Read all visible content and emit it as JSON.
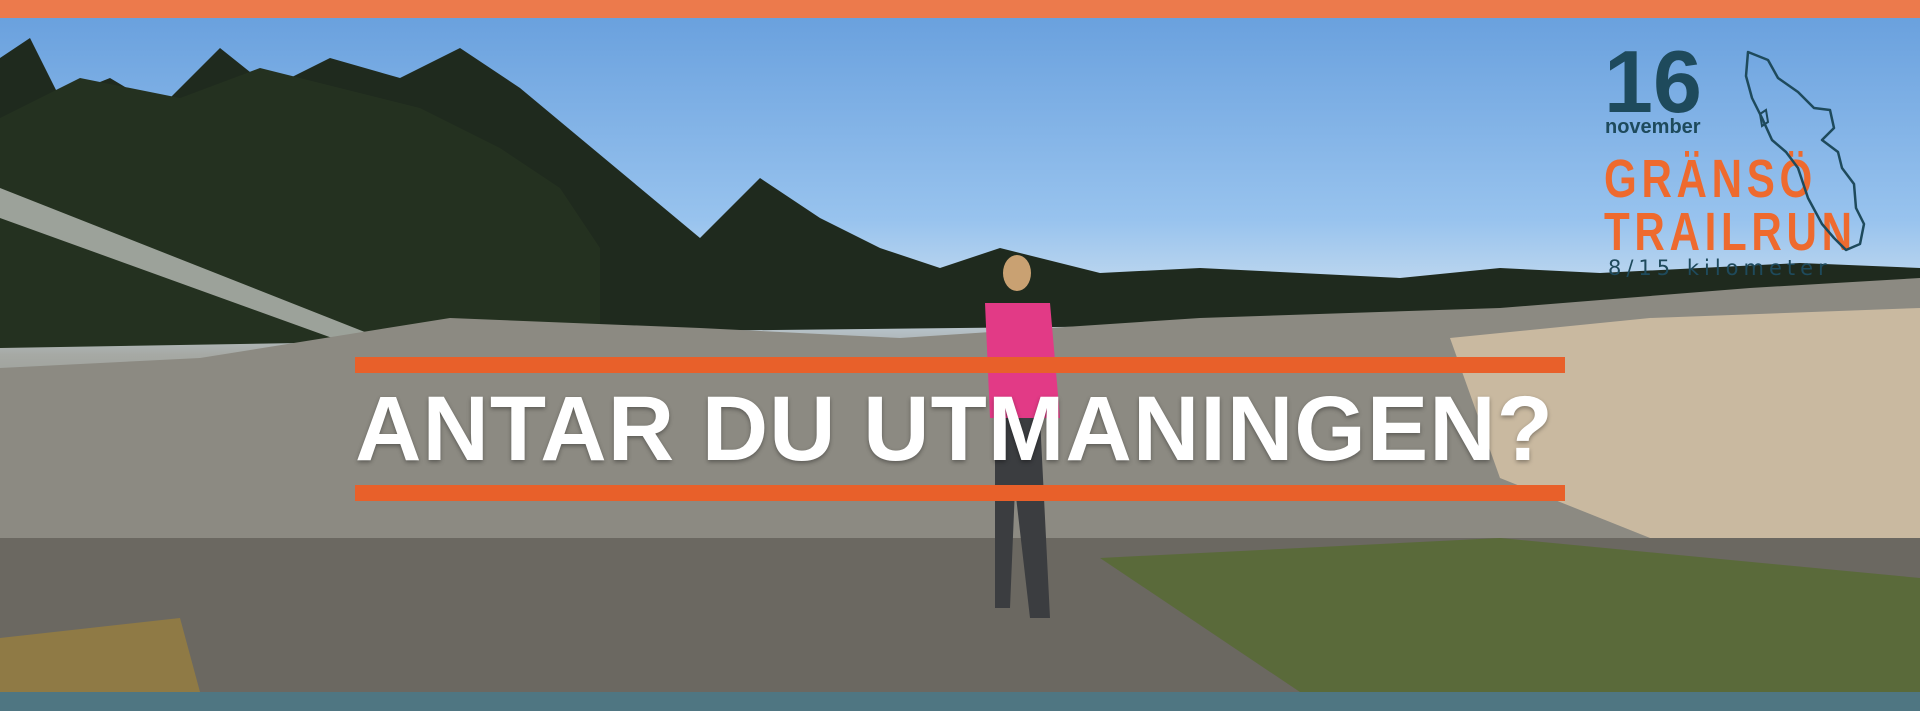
{
  "banner": {
    "headline": "ANTAR DU UTMANINGEN?",
    "accent_color": "#e8602a",
    "top_bar_color": "#ec7a4c",
    "bottom_bar_color": "#4f7682"
  },
  "logo": {
    "day": "16",
    "month": "november",
    "name_line1": "GRÄNSÖ",
    "name_line2": "TRAILRUN",
    "distances": "8/15 kilometer",
    "map_icon": "island-outline-icon"
  }
}
